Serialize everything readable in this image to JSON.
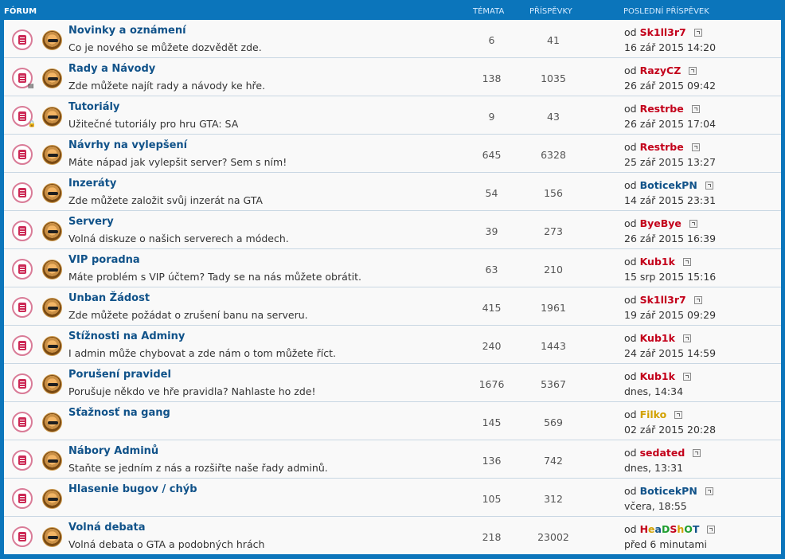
{
  "header": {
    "forum": "FÓRUM",
    "topics": "TÉMATA",
    "posts": "PŘÍSPĚVKY",
    "last_post": "POSLEDNÍ PŘÍSPĚVEK"
  },
  "by_prefix": "od",
  "rows": [
    {
      "title": "Novinky a oznámení",
      "desc": "Co je nového se můžete dozvědět zde.",
      "topics": "6",
      "posts": "41",
      "user": "Sk1ll3r7",
      "user_color": "#c3001a",
      "time": "16 zář 2015 14:20"
    },
    {
      "title": "Rady a Návody",
      "desc": "Zde můžete najít rady a návody ke hře.",
      "topics": "138",
      "posts": "1035",
      "user": "RazyCZ",
      "user_color": "#c3001a",
      "time": "26 zář 2015 09:42"
    },
    {
      "title": "Tutoriály",
      "desc": "Užitečné tutoriály pro hru GTA: SA",
      "topics": "9",
      "posts": "43",
      "user": "Restrbe",
      "user_color": "#c3001a",
      "time": "26 zář 2015 17:04"
    },
    {
      "title": "Návrhy na vylepšení",
      "desc": "Máte nápad jak vylepšit server? Sem s ním!",
      "topics": "645",
      "posts": "6328",
      "user": "Restrbe",
      "user_color": "#c3001a",
      "time": "25 zář 2015 13:27"
    },
    {
      "title": "Inzeráty",
      "desc": "Zde můžete založit svůj inzerát na GTA",
      "topics": "54",
      "posts": "156",
      "user": "BoticekPN",
      "user_color": "#105289",
      "time": "14 zář 2015 23:31"
    },
    {
      "title": "Servery",
      "desc": "Volná diskuze o našich serverech a módech.",
      "topics": "39",
      "posts": "273",
      "user": "ByeBye",
      "user_color": "#c3001a",
      "time": "26 zář 2015 16:39"
    },
    {
      "title": "VIP poradna",
      "desc": "Máte problém s VIP účtem? Tady se na nás můžete obrátit.",
      "topics": "63",
      "posts": "210",
      "user": "Kub1k",
      "user_color": "#c3001a",
      "time": "15 srp 2015 15:16"
    },
    {
      "title": "Unban Žádost",
      "desc": "Zde můžete požádat o zrušení banu na serveru.",
      "topics": "415",
      "posts": "1961",
      "user": "Sk1ll3r7",
      "user_color": "#c3001a",
      "time": "19 zář 2015 09:29"
    },
    {
      "title": "Stížnosti na Adminy",
      "desc": "I admin může chybovat a zde nám o tom můžete říct.",
      "topics": "240",
      "posts": "1443",
      "user": "Kub1k",
      "user_color": "#c3001a",
      "time": "24 zář 2015 14:59"
    },
    {
      "title": "Porušení pravidel",
      "desc": "Porušuje někdo ve hře pravidla? Nahlaste ho zde!",
      "topics": "1676",
      "posts": "5367",
      "user": "Kub1k",
      "user_color": "#c3001a",
      "time": "dnes, 14:34"
    },
    {
      "title": "Sťažnosť na gang",
      "desc": "",
      "topics": "145",
      "posts": "569",
      "user": "Filko",
      "user_color": "#d2a100",
      "time": "02 zář 2015 20:28"
    },
    {
      "title": "Nábory Adminů",
      "desc": "Staňte se jedním z nás a rozšiřte naše řady adminů.",
      "topics": "136",
      "posts": "742",
      "user": "sedated",
      "user_color": "#c3001a",
      "time": "dnes, 13:31"
    },
    {
      "title": "Hlasenie bugov / chýb",
      "desc": "",
      "topics": "105",
      "posts": "312",
      "user": "BoticekPN",
      "user_color": "#105289",
      "time": "včera, 18:55"
    },
    {
      "title": "Volná debata",
      "desc": "Volná debata o GTA a podobných hrách",
      "topics": "218",
      "posts": "23002",
      "user": "HeaDShOT",
      "user_color": "rainbow",
      "time": "před 6 minutami"
    }
  ],
  "locked_rows": [
    2
  ],
  "subforum_marker_rows": [
    1
  ]
}
